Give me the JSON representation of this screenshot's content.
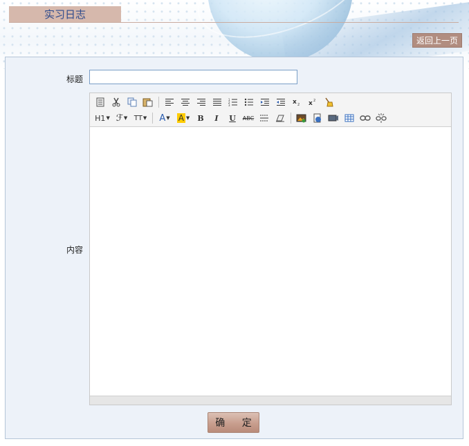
{
  "header": {
    "title": "实习日志",
    "back_label": "返回上一页"
  },
  "form": {
    "title_label": "标题",
    "title_value": "",
    "content_label": "内容",
    "submit_label": "确 定"
  },
  "editor": {
    "toolbar_row1": [
      "paste-word-icon",
      "cut-icon",
      "copy-icon",
      "paste-icon",
      "align-left-icon",
      "align-center-icon",
      "align-right-icon",
      "align-justify-icon",
      "ordered-list-icon",
      "unordered-list-icon",
      "indent-icon",
      "outdent-icon",
      "subscript-icon",
      "superscript-icon",
      "clear-format-icon"
    ],
    "toolbar_row2": {
      "heading": "H1",
      "font": "ℱ",
      "size": "TT",
      "font_color": "A",
      "highlight": "A",
      "bold": "B",
      "italic": "I",
      "underline": "U",
      "strike": "ABC"
    }
  },
  "colors": {
    "tab_bg": "#d6b8ac",
    "tab_text": "#2d4a8c",
    "back_btn_bg": "#b18d80",
    "panel_bg": "#edf2f9",
    "panel_border": "#b5c5d8"
  }
}
